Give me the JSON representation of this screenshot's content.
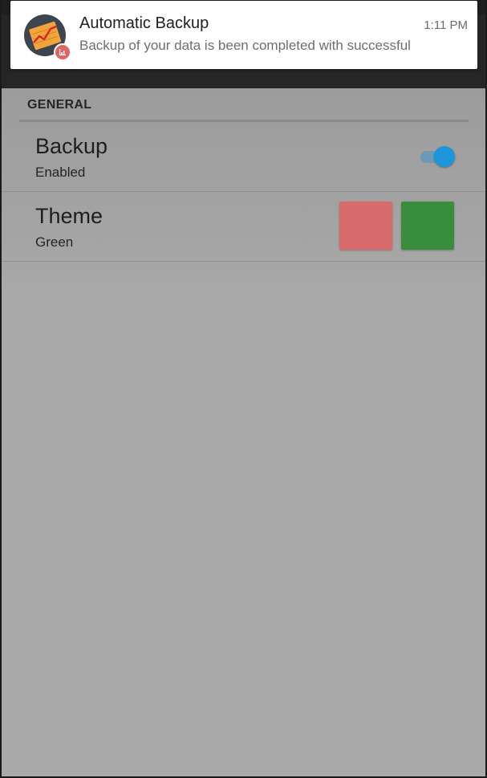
{
  "notification": {
    "title": "Automatic Backup",
    "time": "1:11 PM",
    "text": "Backup of your data is been completed with successful",
    "app_icon": "chart-app-icon",
    "badge_icon": "bar-chart-icon",
    "badge_color": "#e06464"
  },
  "settings": {
    "section_header": "GENERAL",
    "backup": {
      "title": "Backup",
      "summary": "Enabled",
      "enabled": true,
      "accent_color": "#1c95db"
    },
    "theme": {
      "title": "Theme",
      "summary": "Green",
      "swatches": [
        {
          "name": "red",
          "color": "#d76b6b"
        },
        {
          "name": "green",
          "color": "#388e3c"
        }
      ]
    }
  }
}
